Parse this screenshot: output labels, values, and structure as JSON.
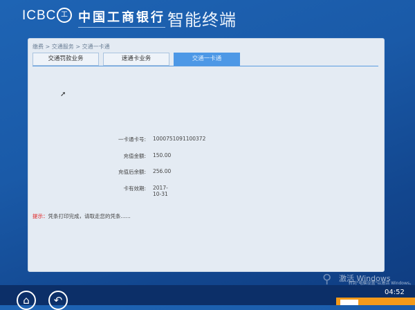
{
  "header": {
    "logo": "ICBC",
    "seal": "工",
    "bank_name": "中国工商银行",
    "terminal": "智能终端"
  },
  "breadcrumb": "缴费 > 交通服务 > 交通一卡通",
  "tabs": [
    {
      "label": "交通罚款业务"
    },
    {
      "label": "速通卡业务"
    },
    {
      "label": "交通一卡通",
      "active": true
    }
  ],
  "details": [
    {
      "label": "一卡通卡号:",
      "value": "1000751091100372"
    },
    {
      "label": "充值金额:",
      "value": "150.00"
    },
    {
      "label": "充值后余额:",
      "value": "256.00"
    },
    {
      "label": "卡有效期:",
      "value": "2017-10-31"
    }
  ],
  "tip": {
    "prefix": "提示：",
    "text": "凭条打印完成，请取走您的凭条......"
  },
  "watermark": {
    "title": "激活 Windows",
    "subtitle": "转到\"电脑设置\"以激活 Windows。"
  },
  "clock": "04:52",
  "icons": [
    "home-icon",
    "back-icon"
  ]
}
